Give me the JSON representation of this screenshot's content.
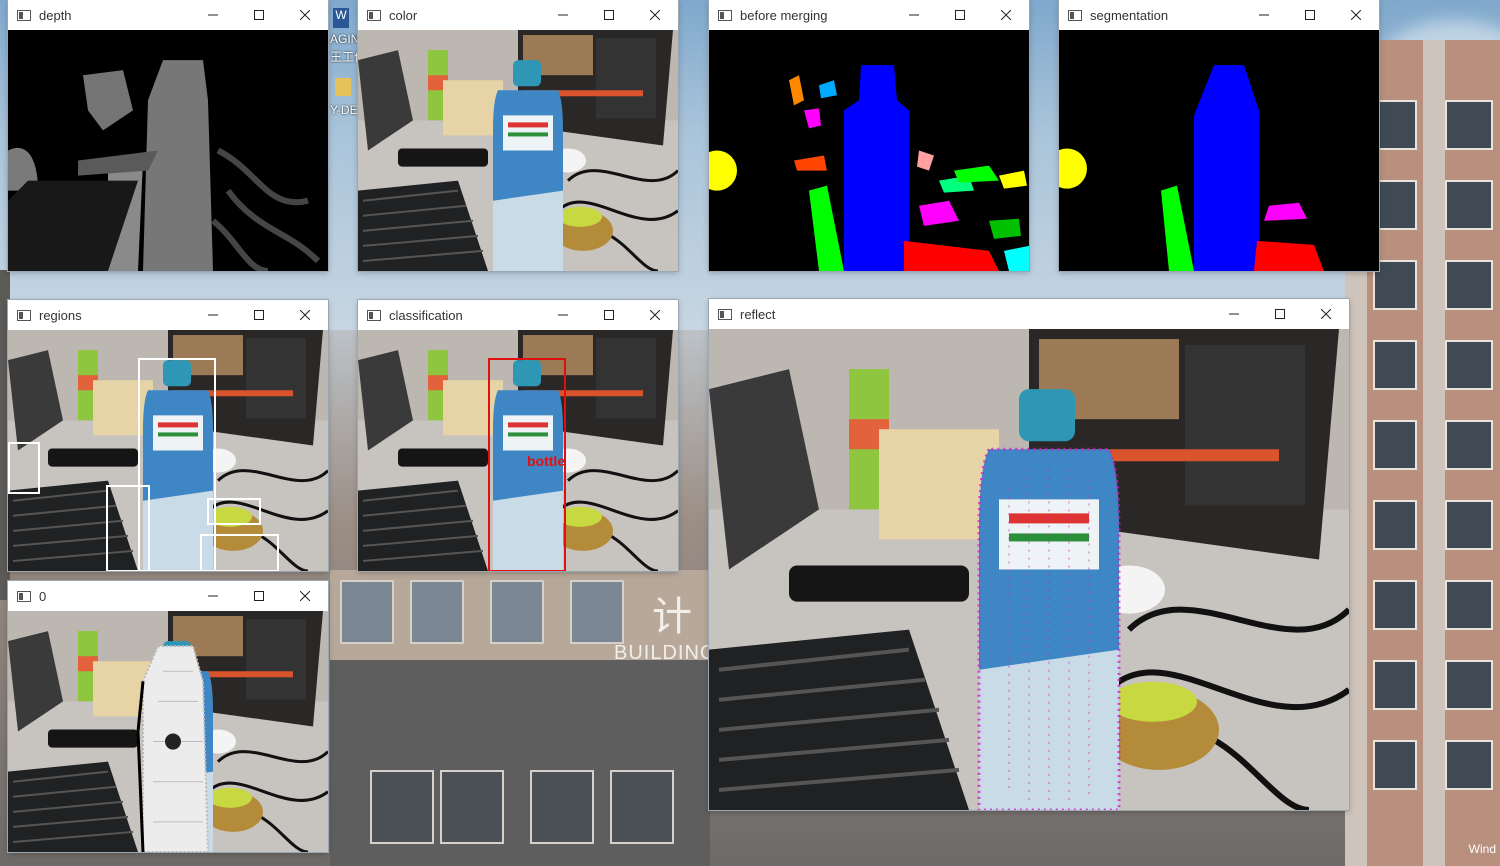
{
  "desktop": {
    "icon_labels": [
      "AGINE",
      "王工作",
      "Y-DES"
    ],
    "taskbar_corner_text": "Wind"
  },
  "overlay_sign": {
    "big": "计",
    "text": "BUILDING"
  },
  "windows": [
    {
      "id": "depth",
      "title": "depth"
    },
    {
      "id": "color",
      "title": "color"
    },
    {
      "id": "before-merging",
      "title": "before merging"
    },
    {
      "id": "segmentation",
      "title": "segmentation"
    },
    {
      "id": "regions",
      "title": "regions"
    },
    {
      "id": "classification",
      "title": "classification"
    },
    {
      "id": "reflect",
      "title": "reflect"
    },
    {
      "id": "zero",
      "title": "0"
    }
  ],
  "classification": {
    "label": "bottle",
    "box_color": "#e01010"
  },
  "segment_colors": {
    "bottle": "#0000ff",
    "left_object": "#00ff00",
    "yellow_blob": "#ffff00",
    "magenta": "#ff00ff",
    "red": "#ff0000",
    "cyan": "#00ffff"
  },
  "icons": {
    "window": "window-app-icon",
    "minimize": "minimize-icon",
    "maximize": "maximize-icon",
    "close": "close-icon"
  }
}
